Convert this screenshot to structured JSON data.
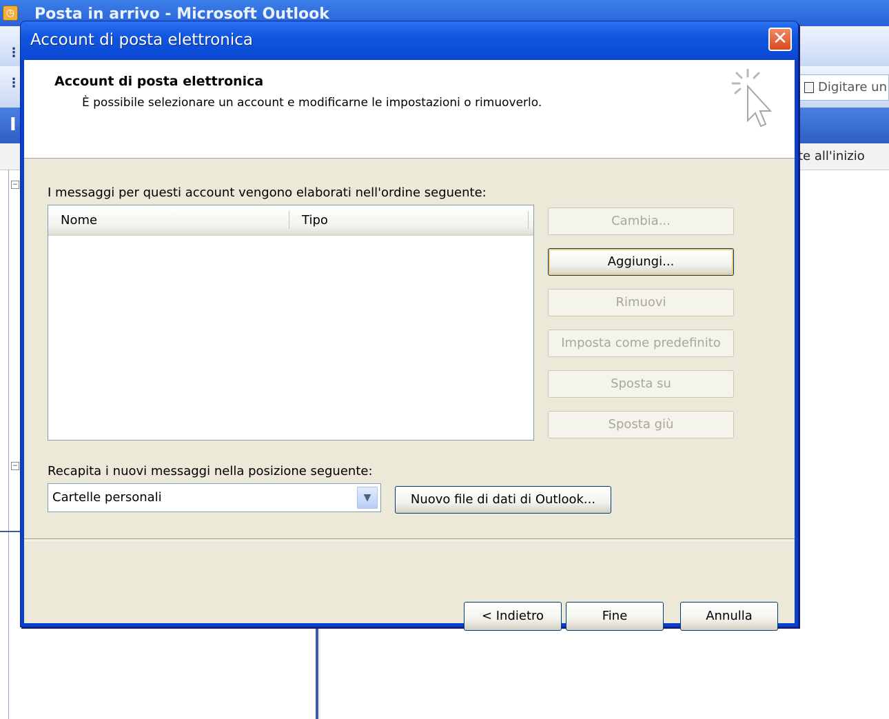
{
  "background_window": {
    "title": "Posta in arrivo - Microsoft Outlook",
    "search_placeholder": "Digitare un",
    "column_fragment": "te all'inizio",
    "header_letter": "I"
  },
  "dialog": {
    "title": "Account di posta elettronica",
    "close_label": "✕",
    "heading": "Account di posta elettronica",
    "subheading": "È possibile selezionare un account e modificarne le impostazioni o rimuoverlo.",
    "list_label": "I messaggi per questi account vengono elaborati nell'ordine seguente:",
    "list_columns": [
      "Nome",
      "Tipo"
    ],
    "side_buttons": {
      "change": "Cambia...",
      "add": "Aggiungi...",
      "remove": "Rimuovi",
      "set_default": "Imposta come predefinito",
      "move_up": "Sposta su",
      "move_down": "Sposta giù"
    },
    "delivery_label": "Recapita i nuovi messaggi nella posizione seguente:",
    "delivery_value": "Cartelle personali",
    "new_data_file": "Nuovo file di dati di Outlook...",
    "footer": {
      "back": "< Indietro",
      "finish": "Fine",
      "cancel": "Annulla"
    }
  },
  "colors": {
    "titlebar": "#0a48d2",
    "dialog_face": "#ece9d8",
    "close_button": "#d8481c"
  }
}
